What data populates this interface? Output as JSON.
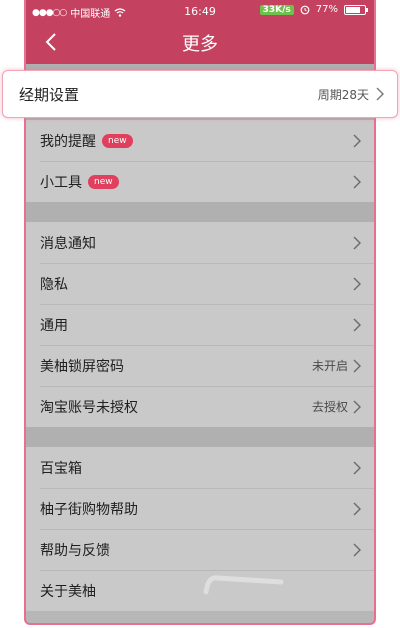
{
  "status_bar": {
    "carrier": "中国联通",
    "time": "16:49",
    "speed": "33K/s",
    "battery_text": "77%",
    "battery_level": 0.77
  },
  "nav": {
    "title": "更多"
  },
  "highlight_row": {
    "label": "经期设置",
    "value": "周期28天"
  },
  "group1": [
    {
      "label": "我的提醒",
      "badge": "new"
    },
    {
      "label": "小工具",
      "badge": "new"
    }
  ],
  "group2": [
    {
      "label": "消息通知"
    },
    {
      "label": "隐私"
    },
    {
      "label": "通用"
    },
    {
      "label": "美柚锁屏密码",
      "value": "未开启"
    },
    {
      "label": "淘宝账号未授权",
      "value": "去授权"
    }
  ],
  "group3": [
    {
      "label": "百宝箱"
    },
    {
      "label": "柚子街购物帮助"
    },
    {
      "label": "帮助与反馈"
    },
    {
      "label": "关于美柚"
    }
  ],
  "colors": {
    "header": "#c4415f",
    "badge": "#e0405d",
    "frame": "#e8708e"
  }
}
